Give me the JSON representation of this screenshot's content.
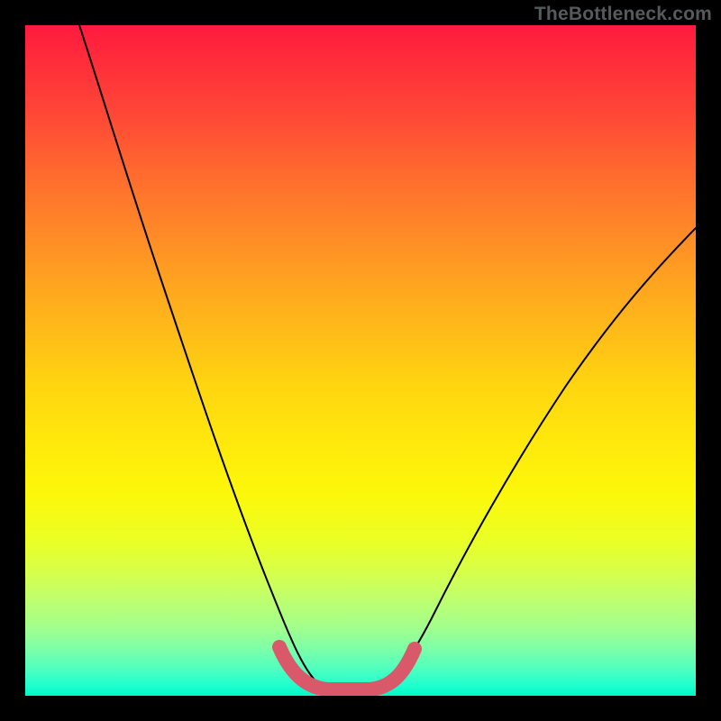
{
  "watermark": "TheBottleneck.com",
  "chart_data": {
    "type": "line",
    "title": "",
    "xlabel": "",
    "ylabel": "",
    "xlim": [
      0,
      100
    ],
    "ylim": [
      0,
      100
    ],
    "grid": false,
    "legend": false,
    "background_gradient": {
      "orientation": "vertical",
      "stops": [
        {
          "pos": 0.0,
          "color": "#ff1a3f"
        },
        {
          "pos": 0.3,
          "color": "#ff8628"
        },
        {
          "pos": 0.6,
          "color": "#ffe80c"
        },
        {
          "pos": 0.85,
          "color": "#bcff71"
        },
        {
          "pos": 1.0,
          "color": "#00f7c5"
        }
      ]
    },
    "series": [
      {
        "name": "bottleneck-curve",
        "stroke": "#000000",
        "points": [
          {
            "x": 8,
            "y": 100
          },
          {
            "x": 12,
            "y": 90
          },
          {
            "x": 16,
            "y": 78
          },
          {
            "x": 20,
            "y": 65
          },
          {
            "x": 24,
            "y": 52
          },
          {
            "x": 28,
            "y": 39
          },
          {
            "x": 31,
            "y": 28
          },
          {
            "x": 34,
            "y": 18
          },
          {
            "x": 37,
            "y": 10
          },
          {
            "x": 40,
            "y": 4
          },
          {
            "x": 43,
            "y": 1
          },
          {
            "x": 47,
            "y": 0
          },
          {
            "x": 51,
            "y": 0
          },
          {
            "x": 54,
            "y": 1
          },
          {
            "x": 57,
            "y": 4
          },
          {
            "x": 61,
            "y": 9
          },
          {
            "x": 66,
            "y": 17
          },
          {
            "x": 72,
            "y": 27
          },
          {
            "x": 79,
            "y": 38
          },
          {
            "x": 86,
            "y": 48
          },
          {
            "x": 93,
            "y": 57
          },
          {
            "x": 100,
            "y": 65
          }
        ]
      },
      {
        "name": "highlight-optimal-range",
        "stroke": "#d9586a",
        "points": [
          {
            "x": 38,
            "y": 7
          },
          {
            "x": 41,
            "y": 2
          },
          {
            "x": 47,
            "y": 0
          },
          {
            "x": 51,
            "y": 0
          },
          {
            "x": 55,
            "y": 2
          },
          {
            "x": 58,
            "y": 6
          }
        ]
      }
    ]
  }
}
